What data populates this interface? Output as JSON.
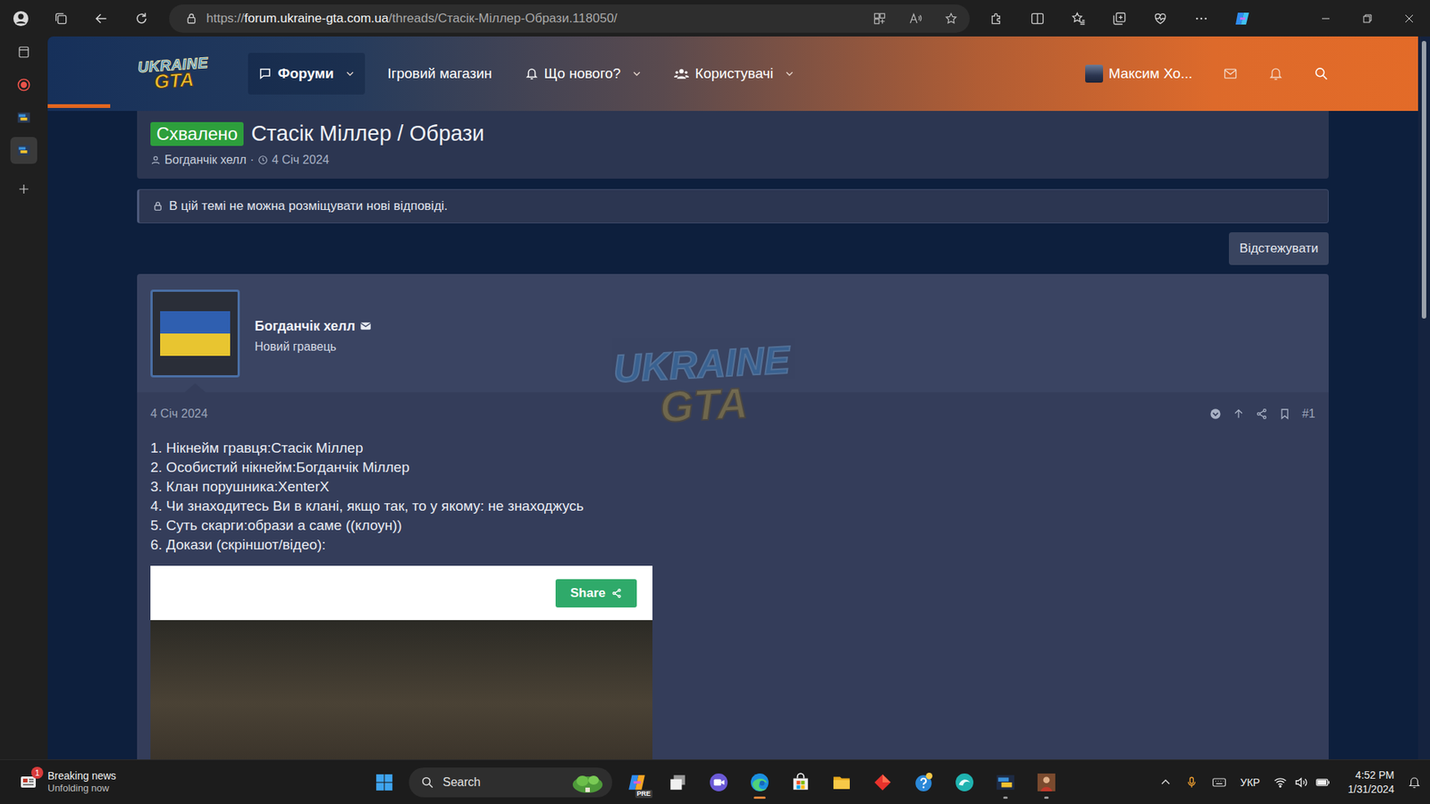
{
  "browser": {
    "url": {
      "scheme": "https://",
      "host": "forum.ukraine-gta.com.ua",
      "path": "/threads/Стасік-Міллер-Образи.118050/"
    }
  },
  "edge_sidebar": {
    "items": [
      {
        "kind": "page",
        "selected": false
      },
      {
        "kind": "record",
        "selected": false
      },
      {
        "kind": "site",
        "selected": false
      },
      {
        "kind": "site",
        "selected": true
      },
      {
        "kind": "add",
        "selected": false
      }
    ]
  },
  "site_header": {
    "logo": {
      "top": "UKRAINE",
      "bottom": "GTA"
    },
    "nav": [
      {
        "label": "Форуми",
        "kind": "chat",
        "selected": true,
        "dropdown": true
      },
      {
        "label": "Ігровий магазин",
        "kind": "plain",
        "selected": false,
        "dropdown": false
      },
      {
        "label": "Що нового?",
        "kind": "bell",
        "selected": false,
        "dropdown": true
      },
      {
        "label": "Користувачі",
        "kind": "users",
        "selected": false,
        "dropdown": true
      }
    ],
    "user": {
      "name": "Максим Хо..."
    }
  },
  "thread": {
    "badge": "Схвалено",
    "title": "Стасік Міллер / Образи",
    "author": "Богданчік хелл",
    "separator": "·",
    "date": "4 Січ 2024",
    "locked_notice": "В цій темі не можна розміщувати нові відповіді.",
    "watch_button": "Відстежувати"
  },
  "post": {
    "author": "Богданчік хелл",
    "role": "Новий гравець",
    "date": "4 Січ 2024",
    "number": "#1",
    "lines": [
      "1. Нікнейм гравця:Стасік Міллер",
      "2. Особистий нікнейм:Богданчік Міллер",
      "3. Клан порушника:XenterX",
      "4. Чи знаходитесь Ви в клані, якщо так, то у якому: не знаходжусь",
      "5. Суть скарги:образи а саме ((клоун))",
      "6. Докази (скріншот/відео):"
    ],
    "embed": {
      "share": "Share"
    }
  },
  "taskbar": {
    "news": {
      "badge": "1",
      "title": "Breaking news",
      "subtitle": "Unfolding now"
    },
    "search": {
      "placeholder": "Search"
    },
    "apps": [
      {
        "kind": "copilot",
        "badge": "PRE",
        "running": false,
        "active": false
      },
      {
        "kind": "taskview",
        "badge": "",
        "running": false,
        "active": false
      },
      {
        "kind": "meet",
        "badge": "",
        "running": false,
        "active": false
      },
      {
        "kind": "edge",
        "badge": "",
        "running": true,
        "active": true
      },
      {
        "kind": "store",
        "badge": "",
        "running": false,
        "active": false
      },
      {
        "kind": "explorer",
        "badge": "",
        "running": false,
        "active": false
      },
      {
        "kind": "diamond",
        "badge": "",
        "running": false,
        "active": false
      },
      {
        "kind": "tips",
        "badge": "",
        "running": false,
        "active": false
      },
      {
        "kind": "teal",
        "badge": "",
        "running": false,
        "active": false
      },
      {
        "kind": "gta",
        "badge": "",
        "running": true,
        "active": false
      },
      {
        "kind": "game",
        "badge": "",
        "running": true,
        "active": false
      }
    ],
    "tray": {
      "language": "УКР",
      "time": "4:52 PM",
      "date": "1/31/2024"
    }
  }
}
